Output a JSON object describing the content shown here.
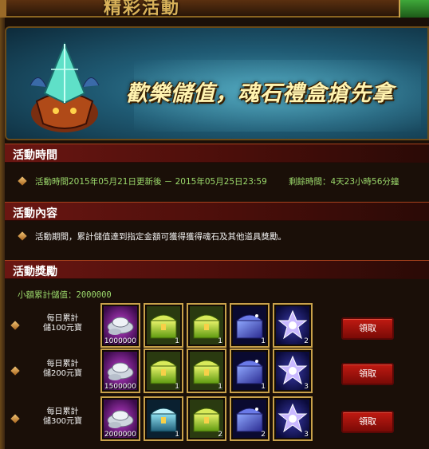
{
  "header": {
    "title_fragment": "精彩活動"
  },
  "banner": {
    "slogan": "歡樂儲值，魂石禮盒搶先拿"
  },
  "sections": {
    "time": {
      "title": "活動時間",
      "text": "活動時間2015年05月21日更新後 － 2015年05月25日23:59",
      "remaining": "剩餘時間：4天23小時56分鐘"
    },
    "content": {
      "title": "活動內容",
      "text": "活動期間，累計儲值達到指定金額可獲得獲得魂石及其他道具獎勵。"
    },
    "rewards": {
      "title": "活動獎勵",
      "small_total": "小額累計儲值：2000000"
    }
  },
  "reward_rows": [
    {
      "label_line1": "每日累計",
      "label_line2": "儲100元寶",
      "items": [
        {
          "icon": "silver-ingot-icon",
          "qty": "1000000"
        },
        {
          "icon": "green-chest-icon",
          "qty": "1"
        },
        {
          "icon": "green-chest-icon",
          "qty": "1"
        },
        {
          "icon": "blue-chest-icon",
          "qty": "1"
        },
        {
          "icon": "soul-crystal-icon",
          "qty": "2"
        }
      ],
      "button": "領取"
    },
    {
      "label_line1": "每日累計",
      "label_line2": "儲200元寶",
      "items": [
        {
          "icon": "silver-ingot-icon",
          "qty": "1500000"
        },
        {
          "icon": "green-chest-icon",
          "qty": "1"
        },
        {
          "icon": "green-chest-icon",
          "qty": "1"
        },
        {
          "icon": "blue-chest-icon",
          "qty": "1"
        },
        {
          "icon": "soul-crystal-icon",
          "qty": "3"
        }
      ],
      "button": "領取"
    },
    {
      "label_line1": "每日累計",
      "label_line2": "儲300元寶",
      "items": [
        {
          "icon": "silver-ingot-icon",
          "qty": "2000000"
        },
        {
          "icon": "teal-chest-icon",
          "qty": "1"
        },
        {
          "icon": "green-chest-icon",
          "qty": "2"
        },
        {
          "icon": "blue-chest-icon",
          "qty": "2"
        },
        {
          "icon": "soul-crystal-icon",
          "qty": "3"
        }
      ],
      "button": "領取"
    }
  ],
  "colors": {
    "section_header": "#6a1612",
    "highlight_text": "#9bd86b",
    "button": "#c01a12",
    "slot_border": "#c9a14a"
  }
}
